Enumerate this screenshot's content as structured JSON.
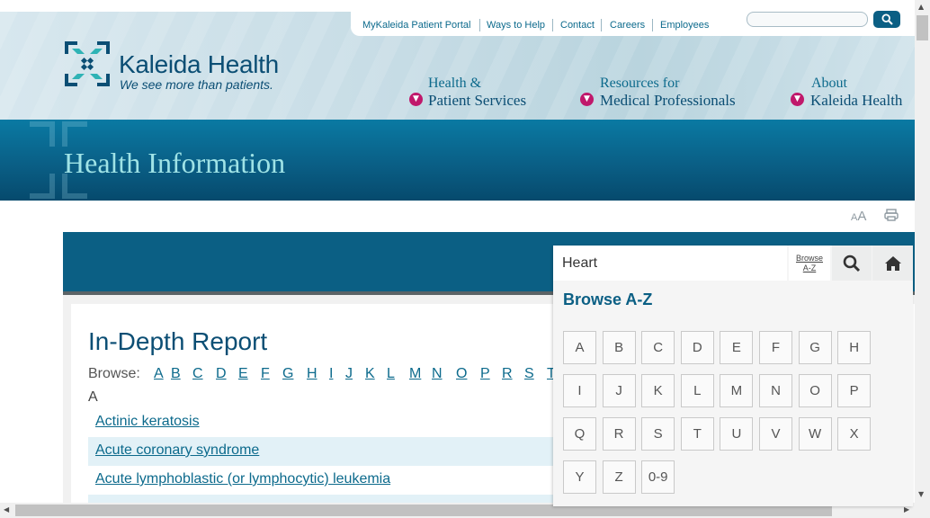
{
  "utility_nav": {
    "items": [
      "MyKaleida Patient Portal",
      "Ways to Help",
      "Contact",
      "Careers",
      "Employees"
    ],
    "search_value": ""
  },
  "brand": {
    "name": "Kaleida Health",
    "tagline": "We see more than patients."
  },
  "main_nav": [
    {
      "line1": "Health &",
      "line2": "Patient Services"
    },
    {
      "line1": "Resources for",
      "line2": "Medical Professionals"
    },
    {
      "line1": "About",
      "line2": "Kaleida Health"
    }
  ],
  "banner": {
    "title": "Health Information"
  },
  "tools": {
    "font_small": "A",
    "font_large": "A"
  },
  "content": {
    "title": "In-Depth Report",
    "browse_label": "Browse:",
    "browse_letters": [
      "A",
      "B",
      "C",
      "D",
      "E",
      "F",
      "G",
      "H",
      "I",
      "J",
      "K",
      "L",
      "M",
      "N",
      "O",
      "P",
      "R",
      "S",
      "T"
    ],
    "section_letter": "A",
    "topics": [
      "Actinic keratosis",
      "Acute coronary syndrome",
      "Acute lymphoblastic (or lymphocytic) leukemia"
    ]
  },
  "search_panel": {
    "query": "Heart",
    "browse_link": "Browse A-Z",
    "heading": "Browse A-Z",
    "letters": [
      "A",
      "B",
      "C",
      "D",
      "E",
      "F",
      "G",
      "H",
      "I",
      "J",
      "K",
      "L",
      "M",
      "N",
      "O",
      "P",
      "Q",
      "R",
      "S",
      "T",
      "U",
      "V",
      "W",
      "X",
      "Y",
      "Z",
      "0-9"
    ]
  },
  "colors": {
    "brand_dark": "#0b4e74",
    "brand_blue": "#0b5f84",
    "link": "#0c6a8c",
    "accent_magenta": "#c0186b",
    "banner_title": "#9fe3e6"
  }
}
